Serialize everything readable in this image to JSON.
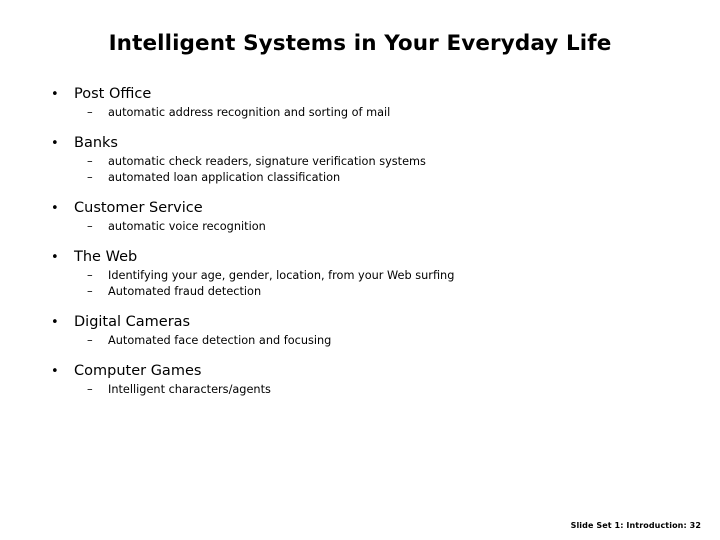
{
  "slide": {
    "title": "Intelligent Systems in Your Everyday Life",
    "bullet_glyph": "•",
    "sub_bullet_glyph": "–",
    "footer": "Slide Set 1: Introduction: 32",
    "topics": [
      {
        "label": "Post Office",
        "sub_items": [
          "automatic address recognition and sorting of mail"
        ]
      },
      {
        "label": "Banks",
        "sub_items": [
          "automatic check readers, signature verification systems",
          "automated loan application classification"
        ]
      },
      {
        "label": "Customer Service",
        "sub_items": [
          "automatic voice recognition"
        ]
      },
      {
        "label": "The Web",
        "sub_items": [
          "Identifying your age, gender, location, from your Web surfing",
          "Automated fraud detection"
        ]
      },
      {
        "label": "Digital Cameras",
        "sub_items": [
          "Automated face detection and focusing"
        ]
      },
      {
        "label": "Computer Games",
        "sub_items": [
          "Intelligent characters/agents"
        ]
      }
    ]
  }
}
